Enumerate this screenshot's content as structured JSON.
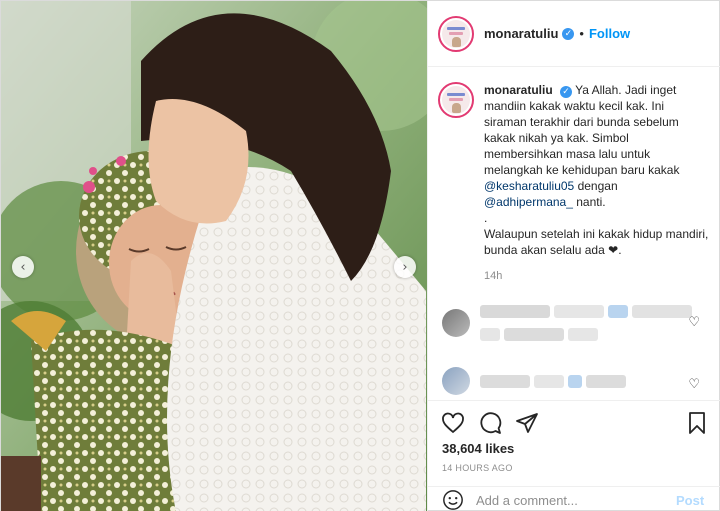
{
  "post": {
    "photo_alt_desc": "",
    "carousel": {
      "prev_icon": "‹",
      "next_icon": "›"
    }
  },
  "header": {
    "username": "monaratuliu",
    "verified_mark": "✓",
    "separator": "•",
    "follow_label": "Follow"
  },
  "caption": {
    "username": "monaratuliu",
    "verified_mark": "✓",
    "text_1": "Ya Allah. Jadi inget mandiin kakak waktu kecil kak. Ini siraman terakhir dari bunda sebelum kakak nikah ya kak. Simbol membersihkan masa lalu untuk melangkah ke kehidupan baru kakak",
    "mention_1": "@kesharatuliu05",
    "text_2": "dengan",
    "mention_2": "@adhipermana_",
    "text_3": "nanti.",
    "dot_line": ".",
    "text_4": "Walaupun setelah ini kakak hidup mandiri, bunda akan selalu ada",
    "heart": "❤",
    "time": "14h"
  },
  "comment_like_icon": "♡",
  "stats": {
    "likes": "38,604 likes",
    "posted": "14 HOURS AGO"
  },
  "comment_form": {
    "placeholder": "Add a comment...",
    "post_label": "Post"
  },
  "colors": {
    "verified": "#3897f0",
    "follow": "#0095f6",
    "avatar_ring": "#e23a72"
  }
}
